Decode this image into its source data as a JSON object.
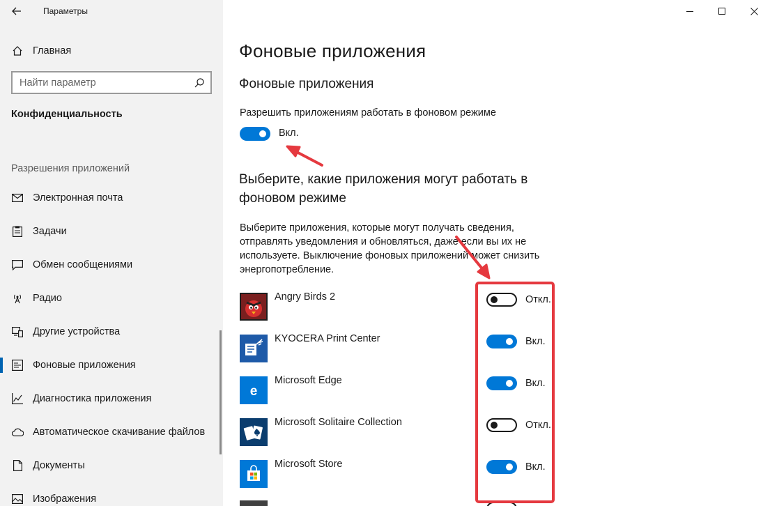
{
  "window": {
    "title": "Параметры",
    "controls": {
      "minimize": "minimize-icon",
      "maximize": "maximize-icon",
      "close": "close-icon"
    }
  },
  "sidebar": {
    "home_label": "Главная",
    "search": {
      "placeholder": "Найти параметр"
    },
    "section_title": "Конфиденциальность",
    "group_label": "Разрешения приложений",
    "items": [
      {
        "label": "Электронная почта",
        "icon": "mail-icon",
        "active": false
      },
      {
        "label": "Задачи",
        "icon": "tasks-icon",
        "active": false
      },
      {
        "label": "Обмен сообщениями",
        "icon": "messaging-icon",
        "active": false
      },
      {
        "label": "Радио",
        "icon": "radio-icon",
        "active": false
      },
      {
        "label": "Другие устройства",
        "icon": "devices-icon",
        "active": false
      },
      {
        "label": "Фоновые приложения",
        "icon": "background-apps-icon",
        "active": true
      },
      {
        "label": "Диагностика приложения",
        "icon": "diagnostics-icon",
        "active": false
      },
      {
        "label": "Автоматическое скачивание файлов",
        "icon": "cloud-icon",
        "active": false
      },
      {
        "label": "Документы",
        "icon": "document-icon",
        "active": false
      },
      {
        "label": "Изображения",
        "icon": "image-icon",
        "active": false
      }
    ]
  },
  "main": {
    "page_title": "Фоновые приложения",
    "section1_title": "Фоновые приложения",
    "allow_label": "Разрешить приложениям работать в фоновом режиме",
    "allow_toggle": {
      "state": "on",
      "text": "Вкл."
    },
    "section2_title": "Выберите, какие приложения могут работать в фоновом режиме",
    "description": "Выберите приложения, которые могут получать сведения, отправлять уведомления и обновляться, даже если вы их не используете. Выключение фоновых приложений может снизить энергопотребление.",
    "apps": [
      {
        "name": "Angry Birds 2",
        "state": "off",
        "toggle_text": "Откл.",
        "icon": "angry-birds-icon"
      },
      {
        "name": "KYOCERA Print Center",
        "state": "on",
        "toggle_text": "Вкл.",
        "icon": "kyocera-icon"
      },
      {
        "name": "Microsoft Edge",
        "state": "on",
        "toggle_text": "Вкл.",
        "icon": "edge-icon"
      },
      {
        "name": "Microsoft Solitaire Collection",
        "state": "off",
        "toggle_text": "Откл.",
        "icon": "solitaire-icon"
      },
      {
        "name": "Microsoft Store",
        "state": "on",
        "toggle_text": "Вкл.",
        "icon": "store-icon"
      }
    ]
  },
  "colors": {
    "accent": "#0078d7",
    "annotation_red": "#e5393f",
    "sidebar_bg": "#f2f2f2"
  }
}
